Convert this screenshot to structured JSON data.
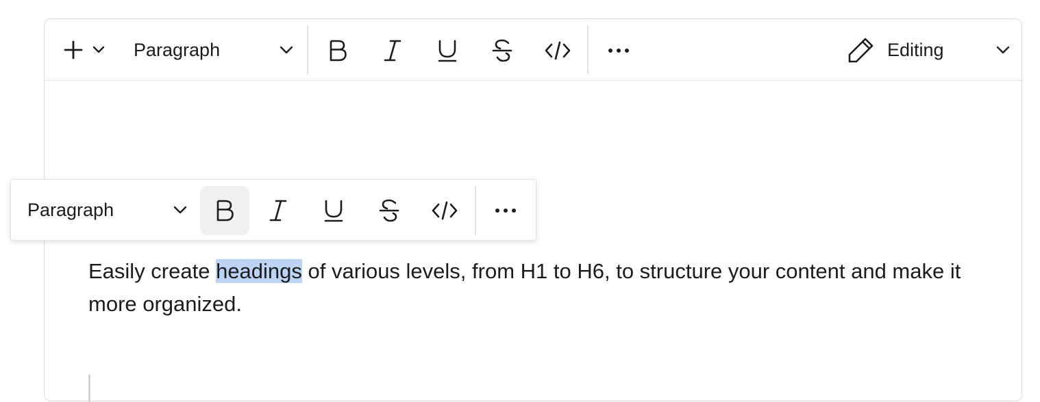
{
  "toolbar": {
    "insert_icon": "plus-icon",
    "block_type": "Paragraph",
    "buttons": [
      "bold-icon",
      "italic-icon",
      "underline-icon",
      "strikethrough-icon",
      "code-icon",
      "more-icon"
    ],
    "mode_label": "Editing",
    "mode_icon": "pencil-icon"
  },
  "floating_toolbar": {
    "block_type": "Paragraph",
    "active_button": "bold"
  },
  "content": {
    "text_before": "Easily create ",
    "selected_text": "headings",
    "text_after": " of various levels, from H1 to H6, to structure your content and make it more organized."
  },
  "colors": {
    "selection": "#bcd3f3",
    "active_button_bg": "#f0f0f1",
    "border": "#dcdcde"
  }
}
